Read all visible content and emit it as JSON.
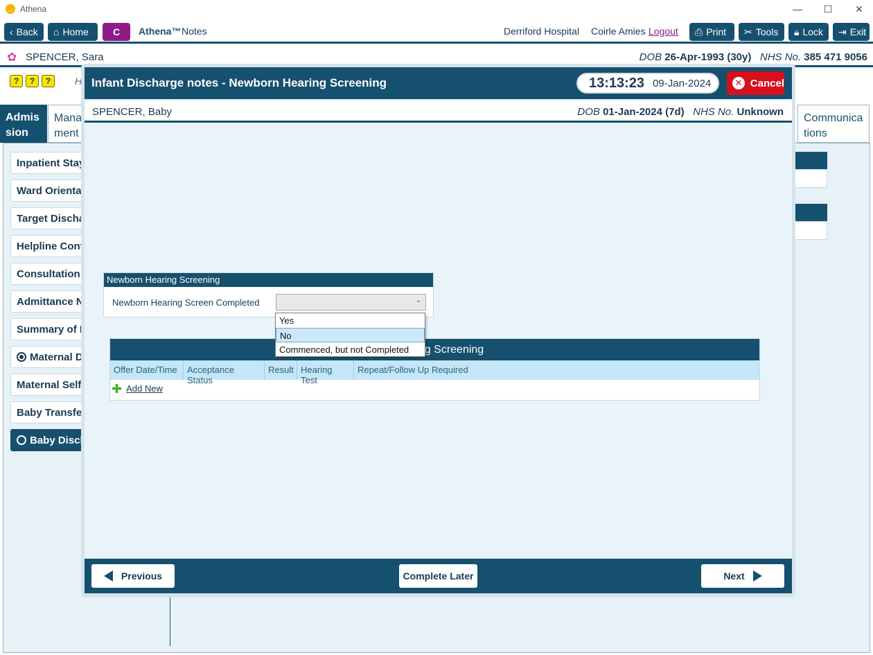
{
  "window": {
    "title": "Athena",
    "minimize_icon": "minimize-icon",
    "maximize_icon": "maximize-icon",
    "close_icon": "close-icon"
  },
  "toolbar": {
    "back_label": "Back",
    "home_label": "Home",
    "c_label": "C",
    "brand": "Athena™",
    "notes_label": "Notes",
    "hospital": "Derriford Hospital",
    "user": "Coirle Amies",
    "logout_label": "Logout",
    "print_label": "Print",
    "tools_label": "Tools",
    "lock_label": "Lock",
    "exit_label": "Exit"
  },
  "patient": {
    "name": "SPENCER, Sara",
    "dob_label": "DOB",
    "dob": "26-Apr-1993 (30y)",
    "nhs_label": "NHS No.",
    "nhs": "385 471 9056"
  },
  "mini_icons": [
    "?",
    "?",
    "?"
  ],
  "header_partial": "H",
  "tabs": {
    "admission": "Admis sion",
    "management": "Mana ment",
    "communications": "Communica tions"
  },
  "sidebar": {
    "items": [
      {
        "label": "Inpatient Stay"
      },
      {
        "label": "Ward Orientati"
      },
      {
        "label": "Target Dischar"
      },
      {
        "label": "Helpline Cont"
      },
      {
        "label": "Consultation I"
      },
      {
        "label": "Admittance N"
      },
      {
        "label": "Summary of P"
      },
      {
        "label": "Maternal Di"
      },
      {
        "label": "Maternal Self"
      },
      {
        "label": "Baby Transfer"
      },
      {
        "label": "Baby Discha"
      }
    ]
  },
  "modal": {
    "title": "Infant Discharge notes - Newborn Hearing Screening",
    "time": "13:13:23",
    "date": "09-Jan-2024",
    "cancel_label": "Cancel",
    "baby": {
      "name": "SPENCER, Baby",
      "dob_label": "DOB",
      "dob": "01-Jan-2024 (7d)",
      "nhs_label": "NHS No.",
      "nhs": "Unknown"
    },
    "card": {
      "title": "Newborn Hearing Screening",
      "field_label": "Newborn Hearing Screen Completed",
      "value": "",
      "options": [
        "Yes",
        "No",
        "Commenced, but not Completed"
      ],
      "highlighted": "No"
    },
    "table": {
      "title_visible": "g Screening",
      "columns": [
        "Offer Date/Time",
        "Acceptance Status",
        "Result",
        "Hearing Test",
        "Repeat/Follow Up Required"
      ],
      "add_new_label": "Add New"
    },
    "footer": {
      "previous_label": "Previous",
      "complete_later_label": "Complete Later",
      "next_label": "Next"
    }
  }
}
